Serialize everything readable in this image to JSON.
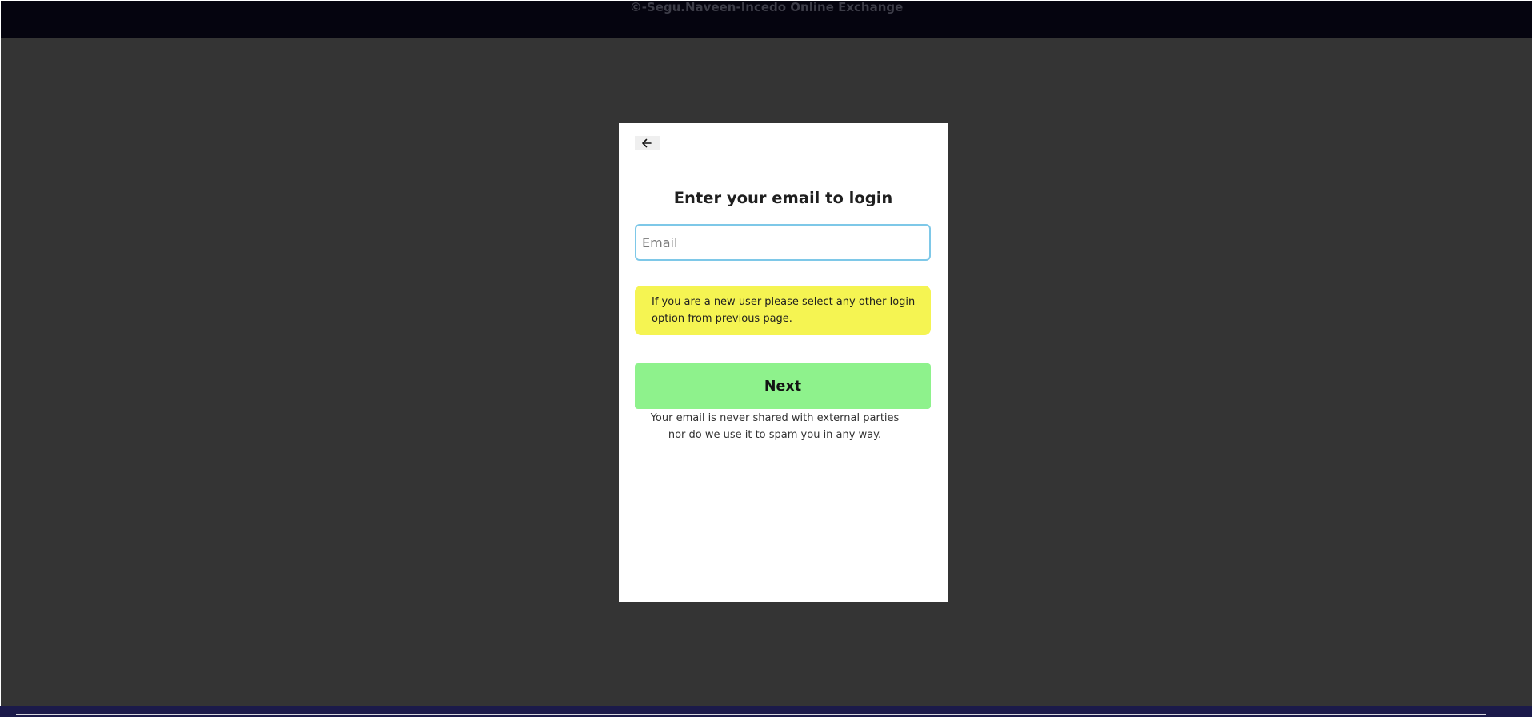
{
  "header": {
    "copyright_text": "©-Segu.Naveen-Incedo Online Exchange"
  },
  "modal": {
    "back_icon": "arrow-left-icon",
    "title": "Enter your email to login",
    "email_input": {
      "value": "",
      "placeholder": "Email"
    },
    "notice_text": "If you are a new user please select any other login option from previous page.",
    "next_label": "Next",
    "privacy_line1": "Your email is never shared with external parties",
    "privacy_line2": "nor do we use it to spam you in any way."
  },
  "colors": {
    "header_bg": "#05040f",
    "overlay_bg": "#343434",
    "notice_bg": "#f5f452",
    "next_button_bg": "#8ef28c",
    "input_focus_border": "#7ec8e8"
  }
}
